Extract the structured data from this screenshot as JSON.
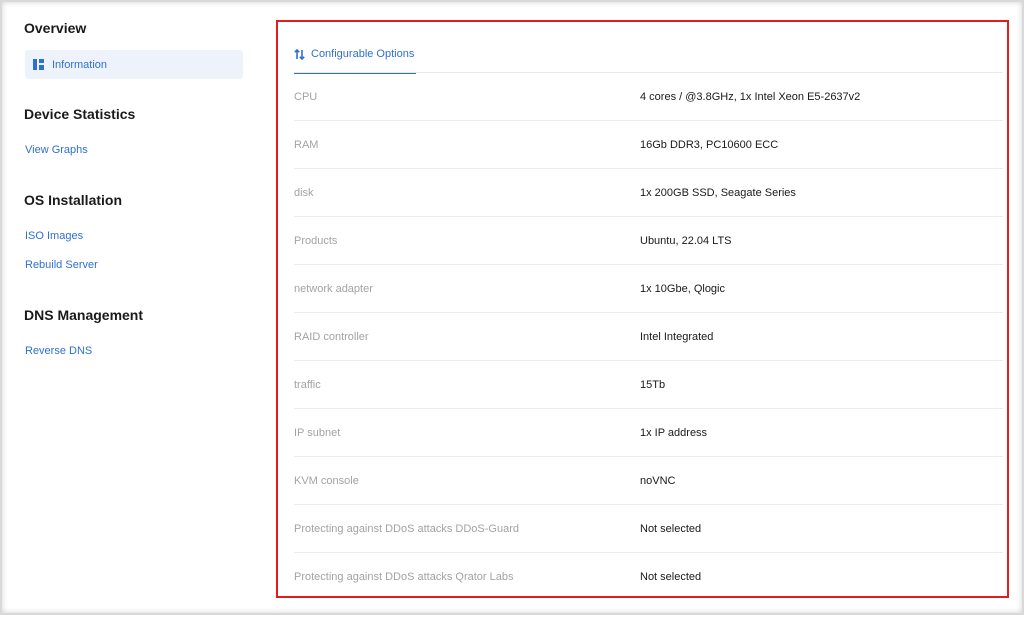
{
  "sidebar": {
    "overview_heading": "Overview",
    "information_label": "Information",
    "device_statistics_heading": "Device Statistics",
    "view_graphs_label": "View Graphs",
    "os_installation_heading": "OS Installation",
    "iso_images_label": "ISO Images",
    "rebuild_server_label": "Rebuild Server",
    "dns_management_heading": "DNS Management",
    "reverse_dns_label": "Reverse DNS"
  },
  "main": {
    "tab_label": "Configurable Options",
    "options": [
      {
        "key": "CPU",
        "value": "4 cores / @3.8GHz, 1x Intel Xeon E5-2637v2"
      },
      {
        "key": "RAM",
        "value": "16Gb DDR3, PC10600 ECC"
      },
      {
        "key": "disk",
        "value": "1x 200GB SSD, Seagate Series"
      },
      {
        "key": "Products",
        "value": "Ubuntu, 22.04 LTS"
      },
      {
        "key": "network adapter",
        "value": "1x 10Gbe, Qlogic"
      },
      {
        "key": "RAID controller",
        "value": "Intel Integrated"
      },
      {
        "key": "traffic",
        "value": "15Tb"
      },
      {
        "key": "IP subnet",
        "value": "1x IP address"
      },
      {
        "key": "KVM console",
        "value": "noVNC"
      },
      {
        "key": "Protecting against DDoS attacks DDoS-Guard",
        "value": "Not selected"
      },
      {
        "key": "Protecting against DDoS attacks Qrator Labs",
        "value": "Not selected"
      }
    ]
  },
  "colors": {
    "accent": "#2f6fd1",
    "highlight_border": "#e11d1d",
    "muted_text": "#a3a3a3"
  },
  "icons": {
    "information": "dashboard-icon",
    "configurable_options": "sort-arrows-icon"
  }
}
